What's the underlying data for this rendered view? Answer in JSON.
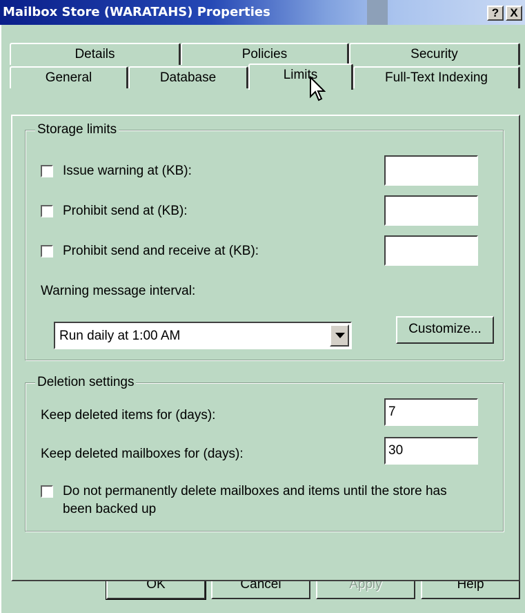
{
  "window": {
    "title": "Mailbox Store (WARATAHS) Properties",
    "help_button": "?",
    "close_button": "X"
  },
  "tabs": {
    "row_back": [
      "Details",
      "Policies",
      "Security"
    ],
    "row_front": [
      "General",
      "Database",
      "Limits",
      "Full-Text Indexing"
    ],
    "active": "Limits"
  },
  "storage_limits": {
    "legend": "Storage limits",
    "issue_warning": {
      "label": "Issue warning at (KB):",
      "checked": false,
      "value": ""
    },
    "prohibit_send": {
      "label": "Prohibit send at (KB):",
      "checked": false,
      "value": ""
    },
    "prohibit_send_receive": {
      "label": "Prohibit send and receive at (KB):",
      "checked": false,
      "value": ""
    },
    "interval_label": "Warning message interval:",
    "interval_value": "Run daily at 1:00 AM",
    "customize_button": "Customize..."
  },
  "deletion_settings": {
    "legend": "Deletion settings",
    "keep_items_label": "Keep deleted items for (days):",
    "keep_items_value": "7",
    "keep_mailboxes_label": "Keep deleted mailboxes for (days):",
    "keep_mailboxes_value": "30",
    "backup_checkbox_line1": "Do not permanently delete mailboxes and items until the store has",
    "backup_checkbox_line2": "been backed up",
    "backup_checked": false
  },
  "buttons": {
    "ok": "OK",
    "cancel": "Cancel",
    "apply": "Apply",
    "help": "Help"
  },
  "colors": {
    "background": "#bcd9c4",
    "titlebar_start": "#0a1f8a",
    "titlebar_end": "#c9d9f3"
  },
  "icons": {
    "cursor": "mouse-pointer-icon",
    "dropdown": "chevron-down-icon"
  }
}
